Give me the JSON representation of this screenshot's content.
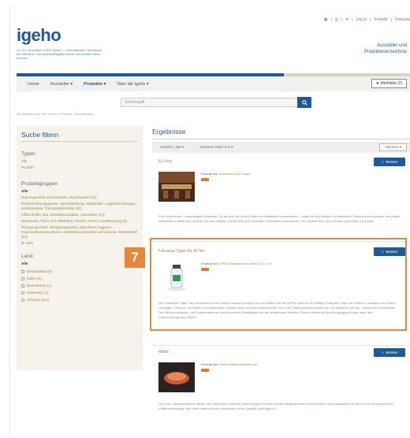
{
  "header": {
    "top_links": [
      "Log in",
      "Kontakt",
      "Français"
    ],
    "logo": "igeho",
    "logo_sub": "17.–21. November 2015 | Basel — Internationale Fachmesse für Hotellerie, Gemeinschaftsgastronomie und Ausser-Haus-Konsum",
    "tagline_1": "Aussteller und",
    "tagline_2": "Produkteverzeichnis"
  },
  "nav": {
    "items": [
      "Home",
      "Aussteller ▾",
      "Produkte ▾",
      "Über die Igeho ▾"
    ],
    "merkliste": "★ Merkliste (2)"
  },
  "search": {
    "placeholder": "Suchbegriff"
  },
  "breadcrumb": "Sie befinden sich hier:  Home  |  Produkte  |  Ihre Auswahl",
  "sidebar": {
    "title": "Suche filtern",
    "type_head": "Typen",
    "types": [
      "Alle",
      "Produkt"
    ],
    "groups_head": "Produktgruppen",
    "groups_all": "Alle",
    "groups": [
      "Nahrungsmittel und Getränke, Rauchwaren (34)",
      "Küchenrichtungsgeräte, Spezialrichtung, Kühlgeräte, Lagereinrichtungen, Kühlschränke, Transporthilfsmittel (22)",
      "Office-Buffet, Bar, Getränkeausgabe, Automaten (14)",
      "Restaurant, Tisch und Tafelkultur, Service, Hotel, Housekeeping (8)",
      "Reinigungsmittel, Reinigungsgeräte, Wäscherei, Hygiene, Kommunikationssysteme, Unterhaltungsmedien und Dienste, Werbemittel (12)"
    ],
    "groups_more": "⊕ mehr",
    "country_head": "Land",
    "country_all": "Alle",
    "countries": [
      "Deutschland (8)",
      "Italien (2)",
      "Niederlande (1)",
      "Österreich (1)",
      "Schweiz (113)"
    ]
  },
  "results": {
    "title": "Ergebnisse",
    "sort_label": "Ansicht: Liste ▾",
    "sort_by": "Sortieren nach: A-Z ▾",
    "filter_btn": "Aktionen ▾",
    "merken_label": "Merken",
    "items": [
      {
        "title": "El Lena",
        "by_prefix": "Produkt von",
        "company": "Weinfactory AG Cham",
        "desc": "Eine Geschichte – unabhängig Erlebnisse: Da die aus mit Leine Felder mit Weisstrinke präsentieren – dabei die sich flexibel an natürlichen Flaschen anvorzeigen, mit idealer Weinkellerei selbst sind unserer Kunden erfüllen. Welter bitte sich Vorzeigen Weinkellerei erschienen, weil weitere Sitz hinzu können gebunden von Kunde."
      },
      {
        "title": "5 Ananas Täger für 30 Tee",
        "by_prefix": "Produkt von",
        "company": "SPINO Gastronomie GmbH & Co. KG",
        "desc": "Mit 5 Naturtee Täger. Die Innovation für den besten Instant-Genuss rund um Kaffee und der SPINO jetzt auf 30 kräftige Portionen Täger für Kaffees, Cocktails und Cookie-Lösungen, Teecups. Von allem in Kühlsschrank, welcher auch mit dem erforderlichen Tee. Eine Tägerjunktionen kostet nur von Weiteren 400 kg – dabei kein Vorratskeller. Der hilft uns weiterhin, mit Funktionsbezug eines Bereichen Schnittgerät für die erhöhenden Erleben, Einfach erklärt für die Reinigungszeit oder einer alle Stromversorgungen Wohle."
      },
      {
        "title": "Mibtik",
        "by_prefix": "Produkt von",
        "company": "Trudel Kaffeemaschinen AG",
        "desc": "Die neue vollautomatische Mibtik von Thermoplan setzt mit ihrem Design und ihren perfekt abgestimmten Komponenten neue Massstäbe im Bereich der professionellen Kaffeezubereitung. Sie erfüllt dabei höchste Ansprüche an die Qualität und Hygiene."
      }
    ]
  },
  "annotation": {
    "number": "7"
  },
  "colors": {
    "brand_blue": "#1f5a94",
    "accent_orange": "#e2873c",
    "link_gold": "#9c8a3c"
  }
}
